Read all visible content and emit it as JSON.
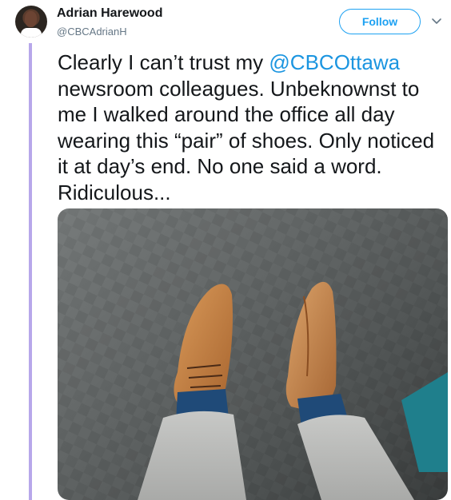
{
  "tweet": {
    "author": {
      "name": "Adrian Harewood",
      "handle": "@CBCAdrianH"
    },
    "follow_label": "Follow",
    "text": {
      "part1": "Clearly I can’t trust my ",
      "mention": "@CBCOttawa",
      "part2": " newsroom colleagues. Unbeknownst to me I walked  around the office all day wearing this “pair” of shoes. Only noticed it at day’s end. No one said a word. Ridiculous..."
    },
    "icons": {
      "avatar": "profile-photo",
      "menu": "chevron-down-icon"
    },
    "colors": {
      "accent": "#1da1f2",
      "mention": "#1b95e0",
      "thread_line": "#b7a7ea",
      "handle": "#657786"
    }
  }
}
